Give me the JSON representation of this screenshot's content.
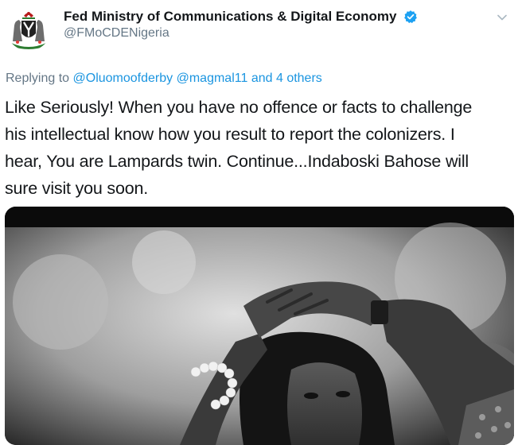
{
  "header": {
    "display_name": "Fed Ministry of Communications & Digital Economy",
    "handle": "@FMoCDENigeria",
    "avatar_icon": "nigeria-coat-of-arms-icon",
    "verified_icon": "verified-badge-icon",
    "menu_icon": "chevron-down-icon"
  },
  "reply": {
    "prefix": "Replying to",
    "mention_1": "@Oluomoofderby",
    "mention_2": "@magmal11",
    "and_word": "and",
    "others": "4 others"
  },
  "tweet": {
    "line_1": "Like Seriously! When you have no offence or facts to challenge",
    "line_2": "his intellectual know how you result to report the colonizers. I",
    "line_3": "hear, You are Lampards twin. Continue...Indaboski Bahose will",
    "line_4": "sure visit you soon."
  },
  "media": {
    "kind": "black-and-white photo",
    "icon": "photo-image"
  },
  "colors": {
    "text": "#14171a",
    "secondary": "#657786",
    "link": "#1b95e0",
    "verified": "#1da1f2"
  }
}
